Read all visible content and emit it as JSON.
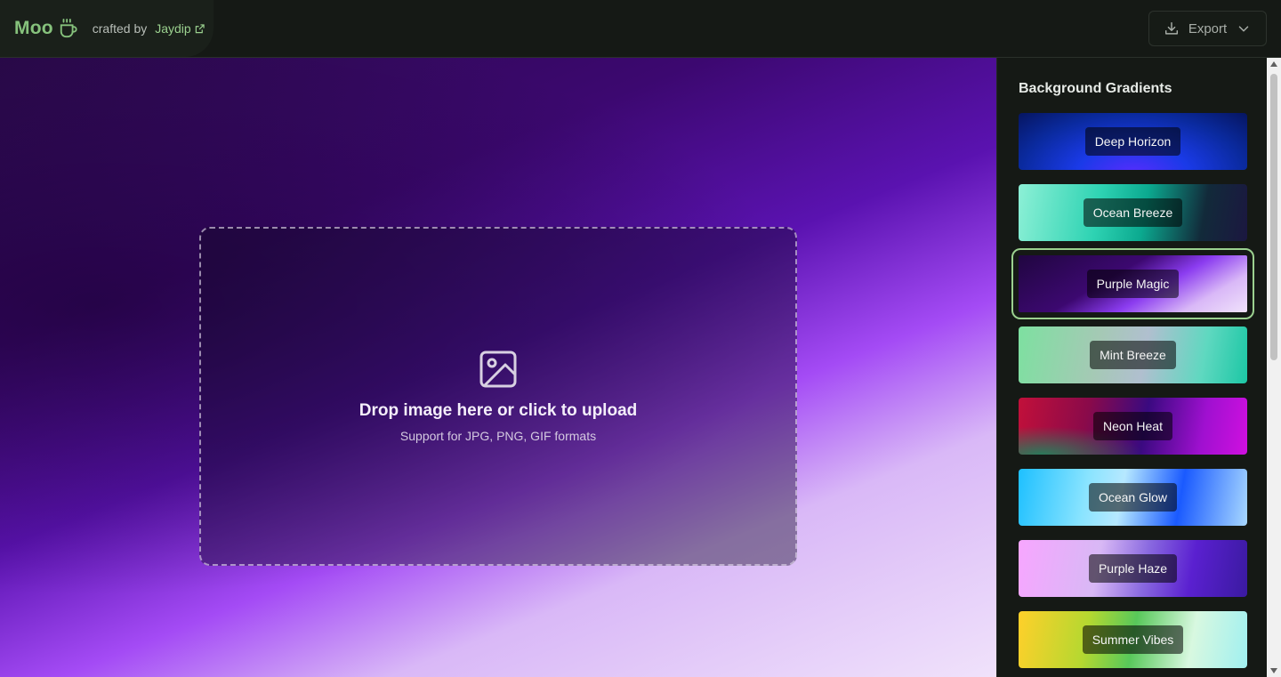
{
  "header": {
    "logo_text": "Moo",
    "crafted_by": "crafted by",
    "author": "Jaydip",
    "export_label": "Export",
    "accent_color": "#86c27c"
  },
  "upload": {
    "title": "Drop image here or click to upload",
    "subtitle": "Support for JPG, PNG, GIF formats"
  },
  "sidebar": {
    "title": "Background Gradients",
    "selected": "Purple Magic",
    "gradients": [
      {
        "label": "Deep Horizon",
        "css": "radial-gradient(ellipse at 50% 110%, #5a2cff 0%, #1a3ae8 35%, #0a2a9e 70%, #061560 100%)"
      },
      {
        "label": "Ocean Breeze",
        "css": "linear-gradient(100deg, #8df0d6 0%, #2ed3b3 35%, #0ba98f 55%, #122a3a 80%, #1b1740 100%)"
      },
      {
        "label": "Purple Magic",
        "css": "linear-gradient(150deg, #200640 0%, #3c0870 40%, #8b3cf0 60%, #d9b8f7 80%, #f0e2fb 100%)"
      },
      {
        "label": "Mint Breeze",
        "css": "linear-gradient(100deg, #7de0a0 0%, #a5c9b5 35%, #b0bfcf 55%, #5fd8c0 80%, #1cc7a5 100%)"
      },
      {
        "label": "Neon Heat",
        "css": "radial-gradient(ellipse at 10% 100%, #2a7a5a 0%, transparent 35%), linear-gradient(100deg, #c2103a 0%, #8a0a4a 30%, #3a0a80 55%, #a010d0 80%, #d010e0 100%)"
      },
      {
        "label": "Ocean Glow",
        "css": "linear-gradient(100deg, #1ec0ff 0%, #8ae4ff 30%, #b6e8ff 45%, #1a5aff 70%, #a8d8ff 100%)"
      },
      {
        "label": "Purple Haze",
        "css": "linear-gradient(100deg, #f7a6ff 0%, #d8b8f5 35%, #8a6ae0 55%, #5a20d0 75%, #3a1aa0 100%)"
      },
      {
        "label": "Summer Vibes",
        "css": "linear-gradient(100deg, #ffd02a 0%, #b5d830 30%, #58c85a 50%, #d8f8e0 75%, #a0f0f0 100%)"
      }
    ]
  }
}
